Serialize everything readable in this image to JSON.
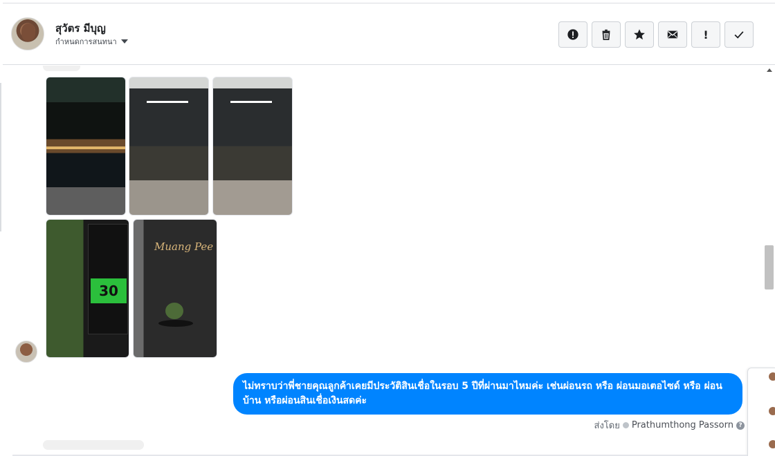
{
  "header": {
    "name": "สุวัตร มีบุญ",
    "subtitle": "กำหนดการสนทนา",
    "actions": [
      {
        "icon": "alert-circle-icon",
        "glyph": ""
      },
      {
        "icon": "trash-icon",
        "glyph": ""
      },
      {
        "icon": "star-icon",
        "glyph": ""
      },
      {
        "icon": "envelope-icon",
        "glyph": ""
      },
      {
        "icon": "exclamation-icon",
        "glyph": "!"
      },
      {
        "icon": "checkmark-icon",
        "glyph": ""
      }
    ]
  },
  "thread": {
    "images": [
      {
        "id": "photo-1"
      },
      {
        "id": "photo-2"
      },
      {
        "id": "photo-3"
      },
      {
        "id": "photo-4",
        "overlay_price": "30"
      },
      {
        "id": "photo-5",
        "overlay_text": "Muang Pee"
      }
    ],
    "outgoing_message": "ไม่ทราบว่าพี่ชายคุณลูกค้าเคยมีประวัติสินเชื่อในรอบ 5 ปีที่ผ่านมาไหมค่ะ เช่นผ่อนรถ หรือ ผ่อนมอเตอไซด์ หรือ ผ่อนบ้าน หรือผ่อนสินเชื่อเงินสดค่ะ",
    "sent_by_label": "ส่งโดย",
    "sent_by_name": "Prathumthong Passorn",
    "help_glyph": "?"
  },
  "colors": {
    "accent": "#0084ff",
    "button_bg": "#f5f6f7"
  }
}
